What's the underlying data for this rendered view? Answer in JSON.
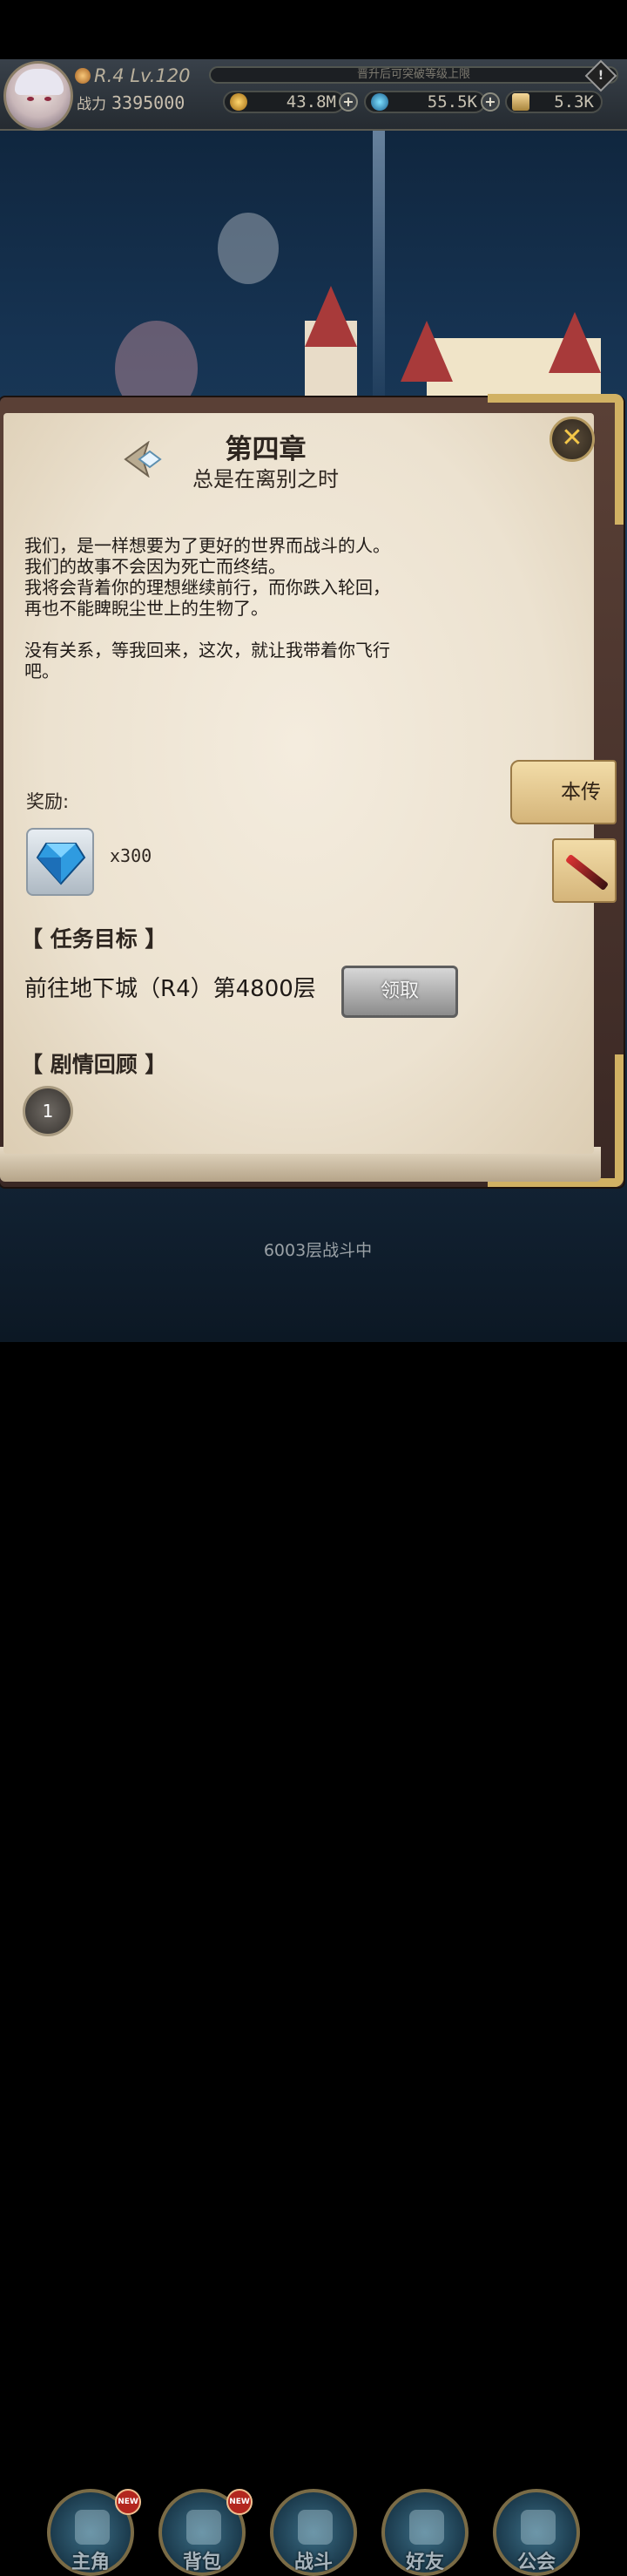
{
  "hud": {
    "rank_level": "R.4 Lv.120",
    "exp_hint": "晋升后可突破等级上限",
    "power_label": "战力",
    "power_value": "3395000",
    "gold": "43.8M",
    "diamond": "55.5K",
    "ticket": "5.3K",
    "plus": "+",
    "warn": "!"
  },
  "chapter": {
    "title": "第四章",
    "subtitle": "总是在离别之时",
    "story": "我们，是一样想要为了更好的世界而战斗的人。\n我们的故事不会因为死亡而终结。\n我将会背着你的理想继续前行，而你跌入轮回，\n再也不能睥睨尘世上的生物了。\n\n没有关系，等我回来，这次，就让我带着你飞行\n吧。",
    "reward_label": "奖励:",
    "reward_qty": "x300",
    "mission_header": "【 任务目标 】",
    "mission_text": "前往地下城（R4）第4800层",
    "claim_label": "领取",
    "review_header": "【 剧情回顾 】",
    "review_episode": "1",
    "close": "✕"
  },
  "side_tabs": {
    "bio": "本传"
  },
  "battle_status": "6003层战斗中",
  "nav": {
    "items": [
      {
        "label": "主角",
        "badge": "NEW"
      },
      {
        "label": "背包",
        "badge": "NEW"
      },
      {
        "label": "战斗"
      },
      {
        "label": "好友"
      },
      {
        "label": "公会"
      }
    ]
  },
  "colors": {
    "gold_accent": "#d1b163",
    "paper": "#ece2d0",
    "frame": "#4a332c",
    "close_x": "#f4c748"
  }
}
